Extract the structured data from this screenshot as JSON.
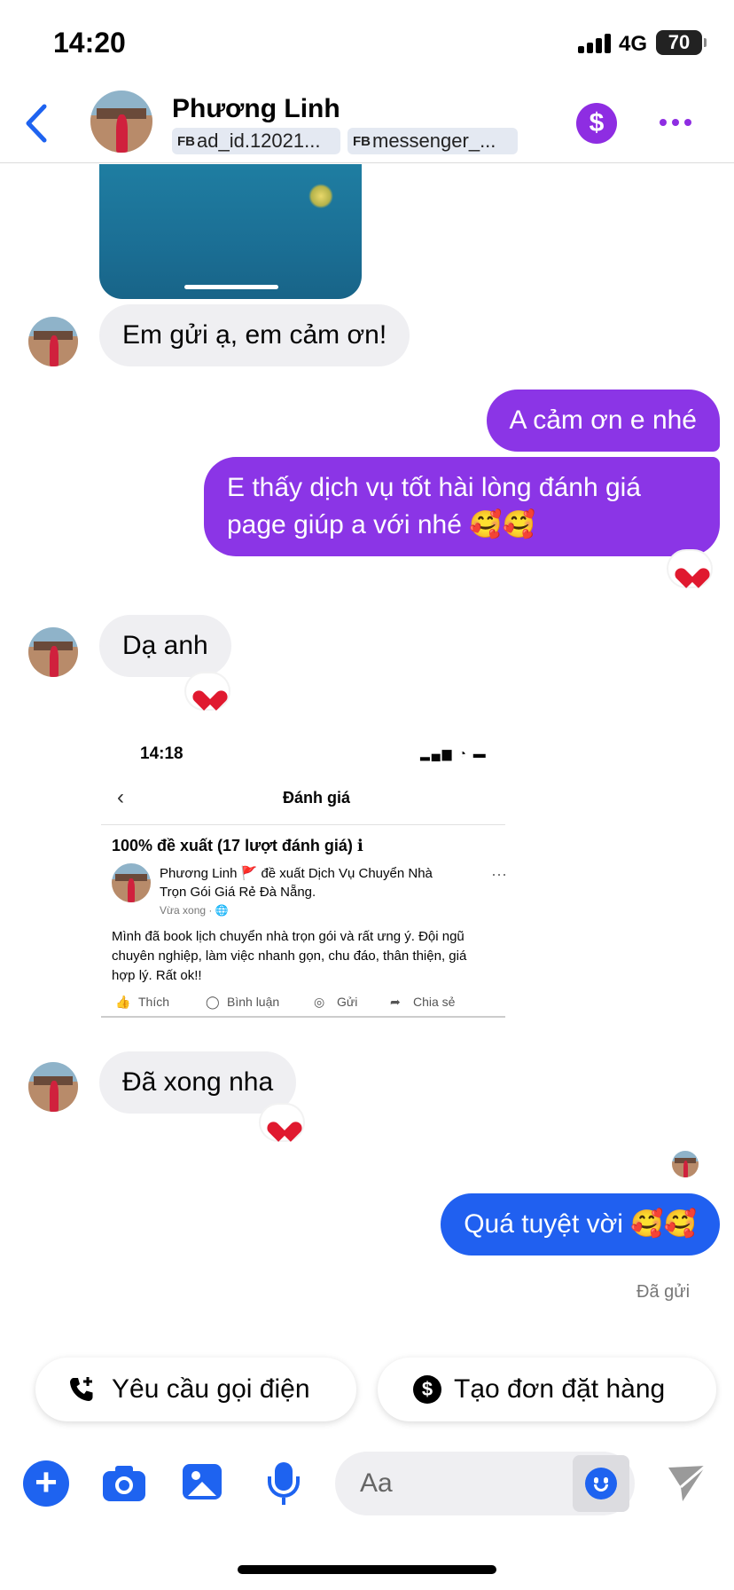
{
  "status_bar": {
    "time": "14:20",
    "network": "4G",
    "battery": "70"
  },
  "header": {
    "contact_name": "Phương Linh",
    "tags": [
      {
        "prefix": "FB",
        "label": "ad_id.12021..."
      },
      {
        "prefix": "FB",
        "label": "messenger_..."
      }
    ],
    "payment_icon": "$"
  },
  "messages": {
    "m1": "Em gửi ạ, em cảm ơn!",
    "m2": "A cảm ơn e nhé",
    "m3_line1": "E thấy dịch vụ tốt hài lòng đánh giá",
    "m3_line2": "page giúp a với nhé 🥰🥰",
    "m4": "Dạ anh",
    "m5": "Đã xong nha",
    "m6": "Quá tuyệt vời 🥰🥰",
    "reaction": "❤",
    "sent_status": "Đã gửi"
  },
  "review_screenshot": {
    "time": "14:18",
    "title": "Đánh giá",
    "heading": "100% đề xuất (17 lượt đánh giá) ℹ",
    "line1": "Phương Linh 🚩  đề xuất Dịch Vụ Chuyển Nhà",
    "line2": "Trọn Gói Giá Rẻ Đà Nẵng.",
    "posted": "Vừa xong · 🌐",
    "body": "Mình đã book lịch chuyển nhà trọn gói và rất ưng ý. Đội ngũ chuyên nghiệp, làm việc nhanh gọn, chu đáo, thân thiện, giá hợp lý. Rất ok!!",
    "actions": [
      "Thích",
      "Bình luận",
      "Gửi",
      "Chia sẻ"
    ]
  },
  "quick_replies": {
    "call": "Yêu cầu gọi điện",
    "order": "Tạo đơn đặt hàng",
    "order_icon": "$"
  },
  "composer": {
    "placeholder": "Aa",
    "plus": "+"
  },
  "colors": {
    "accent_purple": "#8b35e6",
    "accent_blue": "#1e63f0",
    "bubble_grey": "#efeff2"
  }
}
